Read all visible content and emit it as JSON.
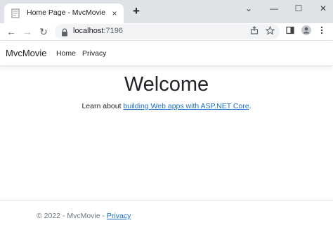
{
  "browser": {
    "tab_title": "Home Page - MvcMovie",
    "tab_close": "×",
    "new_tab": "+",
    "url_host": "localhost",
    "url_port": ":7196",
    "window_controls": {
      "chevron": "⌄",
      "minimize": "—",
      "maximize": "☐",
      "close": "✕"
    },
    "nav": {
      "back": "←",
      "forward": "→",
      "reload": "↻"
    }
  },
  "site": {
    "brand": "MvcMovie",
    "nav_items": [
      "Home",
      "Privacy"
    ]
  },
  "main": {
    "heading": "Welcome",
    "learn_prefix": "Learn about ",
    "learn_link": "building Web apps with ASP.NET Core",
    "learn_suffix": "."
  },
  "footer": {
    "text": "© 2022 - MvcMovie - ",
    "privacy_link": "Privacy"
  },
  "colors": {
    "link": "#1b6ec2",
    "tabstrip": "#dfe3e8",
    "omnibox": "#f1f3f4"
  }
}
